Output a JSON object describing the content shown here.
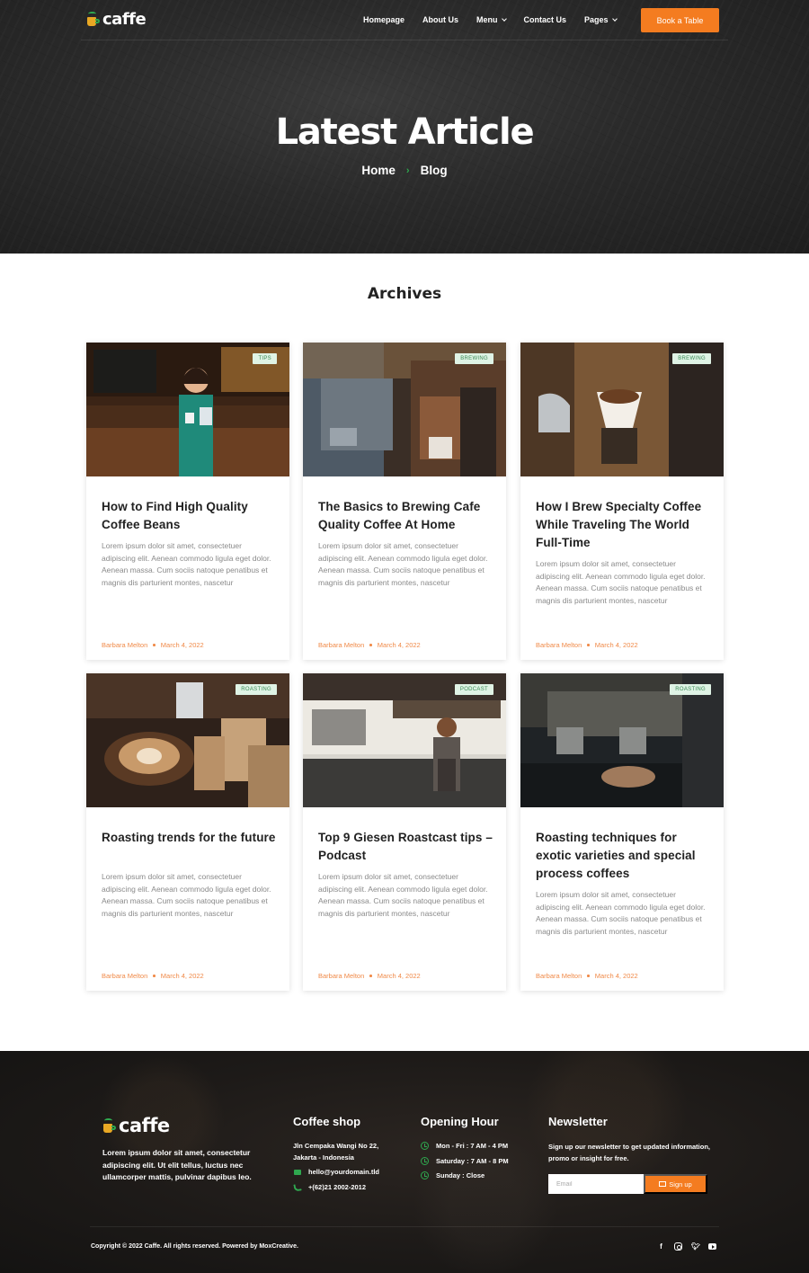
{
  "nav": {
    "logo_text": "caffe",
    "items": [
      {
        "label": "Homepage",
        "dropdown": false
      },
      {
        "label": "About Us",
        "dropdown": false
      },
      {
        "label": "Menu",
        "dropdown": true
      },
      {
        "label": "Contact Us",
        "dropdown": false
      },
      {
        "label": "Pages",
        "dropdown": true
      }
    ],
    "cta_label": "Book a Table"
  },
  "hero": {
    "title": "Latest Article",
    "breadcrumb": [
      "Home",
      "Blog"
    ],
    "separator": "›"
  },
  "archives": {
    "title": "Archives",
    "posts": [
      {
        "tag": "TIPS",
        "title": "How to Find High Quality Coffee Beans",
        "excerpt": "Lorem ipsum dolor sit amet, consectetuer adipiscing elit. Aenean commodo ligula eget dolor. Aenean massa. Cum sociis natoque penatibus et magnis dis parturient montes, nascetur",
        "author": "Barbara Melton",
        "date": "March 4, 2022"
      },
      {
        "tag": "BREWING",
        "title": "The Basics to Brewing Cafe Quality Coffee At Home",
        "excerpt": "Lorem ipsum dolor sit amet, consectetuer adipiscing elit. Aenean commodo ligula eget dolor. Aenean massa. Cum sociis natoque penatibus et magnis dis parturient montes, nascetur",
        "author": "Barbara Melton",
        "date": "March 4, 2022"
      },
      {
        "tag": "BREWING",
        "title": "How I Brew Specialty Coffee While Traveling The World Full-Time",
        "excerpt": "Lorem ipsum dolor sit amet, consectetuer adipiscing elit. Aenean commodo ligula eget dolor. Aenean massa. Cum sociis natoque penatibus et magnis dis parturient montes, nascetur",
        "author": "Barbara Melton",
        "date": "March 4, 2022"
      },
      {
        "tag": "ROASTING",
        "title": "Roasting trends for the future",
        "excerpt": "Lorem ipsum dolor sit amet, consectetuer adipiscing elit. Aenean commodo ligula eget dolor. Aenean massa. Cum sociis natoque penatibus et magnis dis parturient montes, nascetur",
        "author": "Barbara Melton",
        "date": "March 4, 2022"
      },
      {
        "tag": "PODCAST",
        "title": "Top 9 Giesen Roastcast tips – Podcast",
        "excerpt": "Lorem ipsum dolor sit amet, consectetuer adipiscing elit. Aenean commodo ligula eget dolor. Aenean massa. Cum sociis natoque penatibus et magnis dis parturient montes, nascetur",
        "author": "Barbara Melton",
        "date": "March 4, 2022"
      },
      {
        "tag": "ROASTING",
        "title": "Roasting techniques for exotic varieties and special process coffees",
        "excerpt": "Lorem ipsum dolor sit amet, consectetuer adipiscing elit. Aenean commodo ligula eget dolor. Aenean massa. Cum sociis natoque penatibus et magnis dis parturient montes, nascetur",
        "author": "Barbara Melton",
        "date": "March 4, 2022"
      }
    ]
  },
  "footer": {
    "logo_text": "caffe",
    "about": "Lorem ipsum dolor sit amet, consectetur adipiscing elit. Ut elit tellus, luctus nec ullamcorper mattis, pulvinar dapibus leo.",
    "shop": {
      "heading": "Coffee shop",
      "address_line1": "Jln Cempaka Wangi No 22,",
      "address_line2": "Jakarta - Indonesia",
      "email": "hello@yourdomain.tld",
      "phone": "+(62)21 2002-2012"
    },
    "hours": {
      "heading": "Opening Hour",
      "lines": [
        "Mon - Fri : 7 AM - 4 PM",
        "Saturday : 7 AM - 8 PM",
        "Sunday : Close"
      ]
    },
    "newsletter": {
      "heading": "Newsletter",
      "text": "Sign up our newsletter to get updated information, promo or insight for free.",
      "email_placeholder": "Email",
      "button_label": "Sign up"
    },
    "copyright": "Copyright © 2022 Caffe. All rights reserved. Powered by MoxCreative.",
    "socials": [
      "facebook-icon",
      "instagram-icon",
      "twitter-icon",
      "youtube-icon"
    ]
  },
  "colors": {
    "accent": "#f47c20",
    "green": "#2fa84f",
    "meta": "#f08a48",
    "tag_bg": "#dff3e5",
    "hero_bg": "#2a2a2a",
    "footer_bg": "#1d1a18"
  }
}
